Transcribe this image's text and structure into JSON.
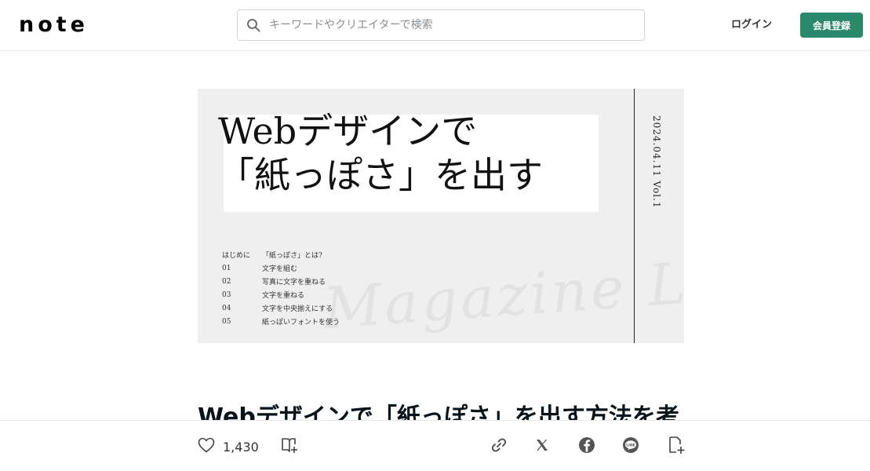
{
  "header": {
    "logo": "note",
    "search_placeholder": "キーワードやクリエイターで検索",
    "login_label": "ログイン",
    "signup_label": "会員登録"
  },
  "hero": {
    "title_line1": "Webデザインで",
    "title_line2": "「紙っぽさ」を出す",
    "date": "2024.04.11  Vol.1",
    "watermark": "Magazine La",
    "toc": [
      {
        "num": "はじめに",
        "text": "「紙っぽさ」とは?"
      },
      {
        "num": "01",
        "text": "文字を組む"
      },
      {
        "num": "02",
        "text": "写真に文字を重ねる"
      },
      {
        "num": "03",
        "text": "文字を重ねる"
      },
      {
        "num": "04",
        "text": "文字を中央揃えにする"
      },
      {
        "num": "05",
        "text": "紙っぽいフォントを使う"
      }
    ]
  },
  "article": {
    "title": "Webデザインで「紙っぽさ」を出す方法を考"
  },
  "actions": {
    "like_count": "1,430"
  },
  "icons": {
    "search": "search-icon",
    "like": "heart-icon",
    "magazine": "add-to-magazine-icon",
    "link": "link-icon",
    "x": "x-icon",
    "facebook": "facebook-icon",
    "line": "line-icon",
    "embed": "embed-icon"
  },
  "colors": {
    "accent": "#2b8a6b",
    "text": "#08131a"
  }
}
